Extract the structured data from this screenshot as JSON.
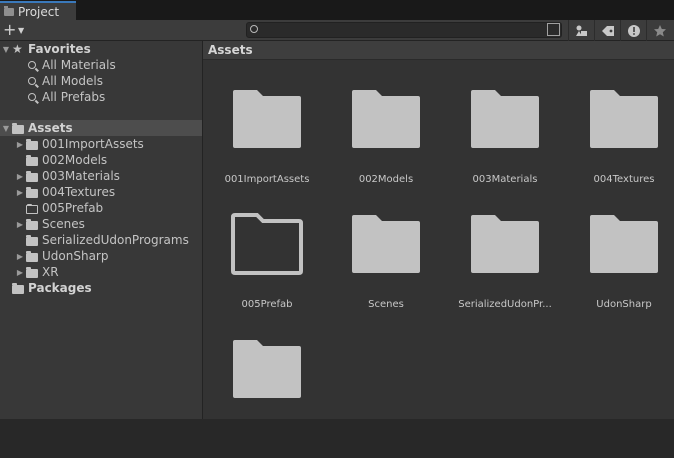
{
  "window": {
    "tab_title": "Project"
  },
  "toolbar": {
    "add_label": "+",
    "search": {
      "value": "",
      "placeholder": ""
    },
    "icons": [
      "scene-filter-icon",
      "label-filter-icon",
      "warning-filter-icon",
      "favorite-icon"
    ]
  },
  "tree": {
    "favorites": {
      "label": "Favorites",
      "items": [
        "All Materials",
        "All Models",
        "All Prefabs"
      ]
    },
    "assets": {
      "label": "Assets",
      "items": [
        {
          "label": "001ImportAssets",
          "has_children": true,
          "empty": false
        },
        {
          "label": "002Models",
          "has_children": false,
          "empty": false
        },
        {
          "label": "003Materials",
          "has_children": true,
          "empty": false
        },
        {
          "label": "004Textures",
          "has_children": true,
          "empty": false
        },
        {
          "label": "005Prefab",
          "has_children": false,
          "empty": true
        },
        {
          "label": "Scenes",
          "has_children": true,
          "empty": false
        },
        {
          "label": "SerializedUdonPrograms",
          "has_children": false,
          "empty": false
        },
        {
          "label": "UdonSharp",
          "has_children": true,
          "empty": false
        },
        {
          "label": "XR",
          "has_children": true,
          "empty": false
        }
      ]
    },
    "packages": {
      "label": "Packages"
    }
  },
  "grid": {
    "breadcrumb": "Assets",
    "items": [
      {
        "label": "001ImportAssets",
        "empty": false
      },
      {
        "label": "002Models",
        "empty": false
      },
      {
        "label": "003Materials",
        "empty": false
      },
      {
        "label": "004Textures",
        "empty": false
      },
      {
        "label": "005Prefab",
        "empty": true
      },
      {
        "label": "Scenes",
        "empty": false
      },
      {
        "label": "SerializedUdonPr...",
        "empty": false
      },
      {
        "label": "UdonSharp",
        "empty": false
      },
      {
        "label": "",
        "empty": false
      }
    ]
  },
  "colors": {
    "selected_tab_accent": "#3a79bb",
    "folder": "#c2c2c2"
  }
}
